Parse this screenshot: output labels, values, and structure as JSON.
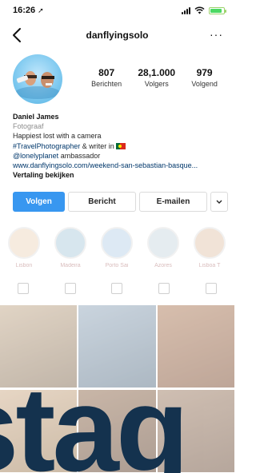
{
  "status_bar": {
    "time": "16:26",
    "location_glyph": "➚"
  },
  "nav": {
    "username": "danflyingsolo",
    "more": "···"
  },
  "profile": {
    "stats": [
      {
        "value": "807",
        "label": "Berichten"
      },
      {
        "value": "28,1.000",
        "label": "Volgers"
      },
      {
        "value": "979",
        "label": "Volgend"
      }
    ],
    "name": "Daniel James",
    "category": "Fotograaf",
    "bio_line1": "Happiest lost with a camera",
    "bio_hashtag": "#TravelPhotographer",
    "bio_writer": " & writer in",
    "bio_mention": "@lonelyplanet",
    "bio_ambassador": " ambassador",
    "website": "www.danflyingsolo.com/weekend-san-sebastian-basque...",
    "translate": "Vertaling bekijken"
  },
  "actions": {
    "follow": "Volgen",
    "message": "Bericht",
    "email": "E-mailen",
    "more_icon": "chevron-down-icon"
  },
  "highlights": [
    {
      "label": "Lisbon",
      "color": "#e7c7a6"
    },
    {
      "label": "Madeira",
      "color": "#8fb8cf"
    },
    {
      "label": "Porto Sai",
      "color": "#9fc3e0"
    },
    {
      "label": "Azores",
      "color": "#b6c9d6"
    },
    {
      "label": "Lisboa T",
      "color": "#d9b18e"
    }
  ],
  "grid_colors": [
    "#b9a48a",
    "#7d93a6",
    "#a87d62",
    "#c7a788",
    "#8f6e55",
    "#9c7b67"
  ],
  "watermark": "stag",
  "colors": {
    "accent": "#3897f0",
    "link": "#00376b"
  }
}
